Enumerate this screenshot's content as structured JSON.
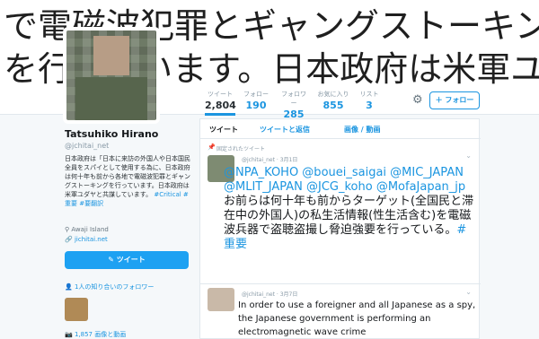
{
  "banner": {
    "line1": "で電磁波犯罪とギャングストーキング",
    "line2": "を行っています。日本政府は米軍ユダ"
  },
  "nav": {
    "stats": [
      {
        "label": "ツイート",
        "value": "2,804"
      },
      {
        "label": "フォロー",
        "value": "190"
      },
      {
        "label": "フォロワー",
        "value": "285"
      },
      {
        "label": "お気に入り",
        "value": "855"
      },
      {
        "label": "リスト",
        "value": "3"
      }
    ],
    "follow_label": "フォロー"
  },
  "profile": {
    "name": "Tatsuhiko Hirano",
    "handle": "@jchitai_net",
    "bio": "日本政府は「日本に来訪の外国人や日本国民全員をスパイとして使用する為に、日本政府は何十年も前から各地で電磁波犯罪とギャングストーキングを行っています。日本政府は米軍ユダヤと共謀しています。",
    "bio_tags": "#Critical #重要 #要翻訳",
    "location": "Awaji Island",
    "url": "jichitai.net",
    "tweet_button": "ツイート",
    "known_followers": "1人の知り合いのフォロワー",
    "media": "1,857 画像と動画"
  },
  "timeline": {
    "tabs": [
      "ツイート",
      "ツイートと返信",
      "画像 / 動画"
    ],
    "tweet1": {
      "pinned_label": "固定されたツイート",
      "handle": "@jchitai_net · 3月1日",
      "mentions": "@NPA_KOHO @bouei_saigai @MIC_JAPAN @MLIT_JAPAN @JCG_koho @MofaJapan_jp",
      "text": "お前らは何十年も前からターゲット(全国民と滞在中の外国人)の私生活情報(性生活含む)を電磁波兵器で盗聴盗撮し脅迫強要を行っている。",
      "hashtag": "#重要"
    },
    "tweet2": {
      "handle": "@jchitai_net · 3月7日",
      "text": "In order to use a foreigner and all Japanese as a spy, the Japanese government is performing an electromagnetic wave crime"
    }
  }
}
